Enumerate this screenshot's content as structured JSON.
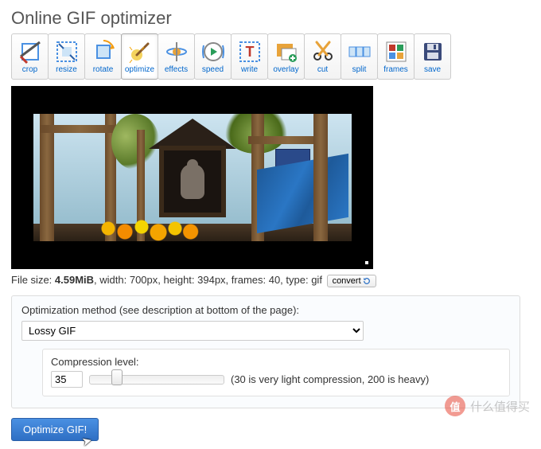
{
  "page_title": "Online GIF optimizer",
  "toolbar": [
    {
      "id": "crop",
      "label": "crop",
      "active": false
    },
    {
      "id": "resize",
      "label": "resize",
      "active": false
    },
    {
      "id": "rotate",
      "label": "rotate",
      "active": false
    },
    {
      "id": "optimize",
      "label": "optimize",
      "active": true
    },
    {
      "id": "effects",
      "label": "effects",
      "active": false
    },
    {
      "id": "speed",
      "label": "speed",
      "active": false
    },
    {
      "id": "write",
      "label": "write",
      "active": false
    },
    {
      "id": "overlay",
      "label": "overlay",
      "active": false
    },
    {
      "id": "cut",
      "label": "cut",
      "active": false
    },
    {
      "id": "split",
      "label": "split",
      "active": false
    },
    {
      "id": "frames",
      "label": "frames",
      "active": false
    },
    {
      "id": "save",
      "label": "save",
      "active": false
    }
  ],
  "file_info": {
    "prefix": "File size: ",
    "size_value": "4.59MiB",
    "mid1": ", width: 700px, height: 394px, frames: 40, type: gif",
    "convert_label": "convert"
  },
  "optimization": {
    "section_label": "Optimization method (see description at bottom of the page):",
    "method_selected": "Lossy GIF",
    "compression_label": "Compression level:",
    "compression_value": "35",
    "compression_hint": "(30 is very light compression, 200 is heavy)"
  },
  "submit_label": "Optimize GIF!",
  "watermark": {
    "badge": "值",
    "text": "什么值得买"
  }
}
